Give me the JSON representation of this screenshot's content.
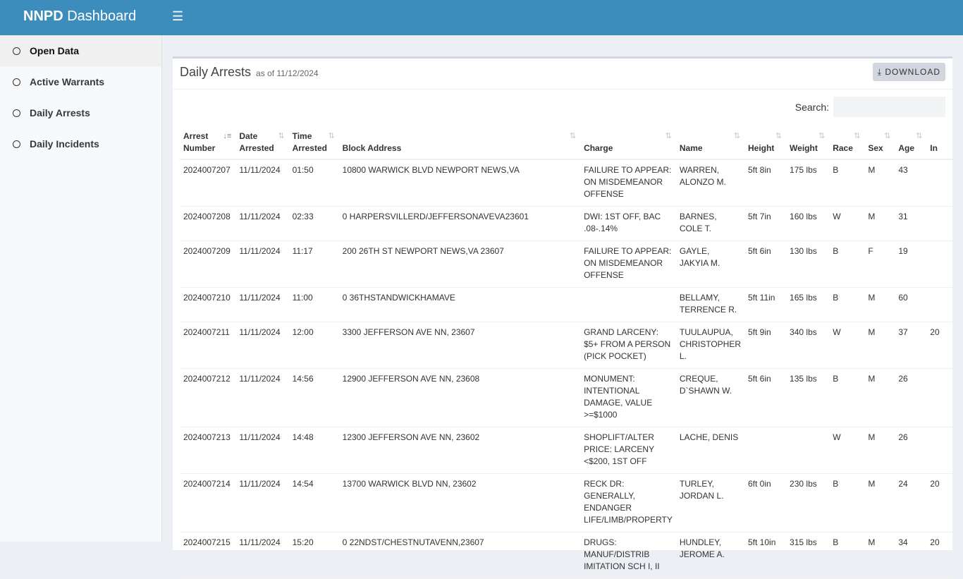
{
  "app": {
    "brand_bold": "NNPD",
    "brand_rest": "Dashboard",
    "menu_icon": "hamburger-icon"
  },
  "sidebar": {
    "items": [
      {
        "label": "Open Data",
        "active": true
      },
      {
        "label": "Active Warrants"
      },
      {
        "label": "Daily Arrests"
      },
      {
        "label": "Daily Incidents"
      }
    ]
  },
  "card": {
    "title": "Daily Arrests",
    "subtitle": "as of 11/12/2024",
    "download_label": "DOWNLOAD",
    "search_label": "Search:",
    "search_value": "",
    "search_placeholder": ""
  },
  "table": {
    "columns": [
      "Arrest Number",
      "Date Arrested",
      "Time Arrested",
      "Block Address",
      "Charge",
      "Name",
      "Height",
      "Weight",
      "Race",
      "Sex",
      "Age",
      "In"
    ],
    "rows": [
      [
        "2024007207",
        "11/11/2024",
        "01:50",
        "10800 WARWICK BLVD NEWPORT NEWS,VA",
        "FAILURE TO APPEAR: ON MISDEMEANOR OFFENSE",
        "WARREN, ALONZO M.",
        "5ft 8in",
        "175 lbs",
        "B",
        "M",
        "43",
        ""
      ],
      [
        "2024007208",
        "11/11/2024",
        "02:33",
        "0 HARPERSVILLERD/JEFFERSONAVEVA23601",
        "DWI: 1ST OFF, BAC .08-.14%",
        "BARNES, COLE T.",
        "5ft 7in",
        "160 lbs",
        "W",
        "M",
        "31",
        ""
      ],
      [
        "2024007209",
        "11/11/2024",
        "11:17",
        "200 26TH ST NEWPORT NEWS,VA 23607",
        "FAILURE TO APPEAR: ON MISDEMEANOR OFFENSE",
        "GAYLE, JAKYIA M.",
        "5ft 6in",
        "130 lbs",
        "B",
        "F",
        "19",
        ""
      ],
      [
        "2024007210",
        "11/11/2024",
        "11:00",
        "0 36THSTANDWICKHAMAVE",
        "",
        "BELLAMY, TERRENCE R.",
        "5ft 11in",
        "165 lbs",
        "B",
        "M",
        "60",
        ""
      ],
      [
        "2024007211",
        "11/11/2024",
        "12:00",
        "3300 JEFFERSON AVE NN, 23607",
        "GRAND LARCENY: $5+ FROM A PERSON (PICK POCKET)",
        "TUULAUPUA, CHRISTOPHER L.",
        "5ft 9in",
        "340 lbs",
        "W",
        "M",
        "37",
        "20"
      ],
      [
        "2024007212",
        "11/11/2024",
        "14:56",
        "12900 JEFFERSON AVE NN, 23608",
        "MONUMENT: INTENTIONAL DAMAGE, VALUE >=$1000",
        "CREQUE, D`SHAWN W.",
        "5ft 6in",
        "135 lbs",
        "B",
        "M",
        "26",
        ""
      ],
      [
        "2024007213",
        "11/11/2024",
        "14:48",
        "12300 JEFFERSON AVE NN, 23602",
        "SHOPLIFT/ALTER PRICE: LARCENY <$200, 1ST OFF",
        "LACHE, DENIS",
        "",
        "",
        "W",
        "M",
        "26",
        ""
      ],
      [
        "2024007214",
        "11/11/2024",
        "14:54",
        "13700 WARWICK BLVD NN, 23602",
        "RECK DR: GENERALLY, ENDANGER LIFE/LIMB/PROPERTY",
        "TURLEY, JORDAN L.",
        "6ft 0in",
        "230 lbs",
        "B",
        "M",
        "24",
        "20"
      ],
      [
        "2024007215",
        "11/11/2024",
        "15:20",
        "0 22NDST/CHESTNUTAVENN,23607",
        "DRUGS: MANUF/DISTRIB IMITATION SCH I, II",
        "HUNDLEY, JEROME A.",
        "5ft 10in",
        "315 lbs",
        "B",
        "M",
        "34",
        "20"
      ]
    ]
  },
  "colors": {
    "header": "#3c8dbc",
    "sidebar": "#f8f9fa",
    "content_bg": "#ecf0f5"
  }
}
